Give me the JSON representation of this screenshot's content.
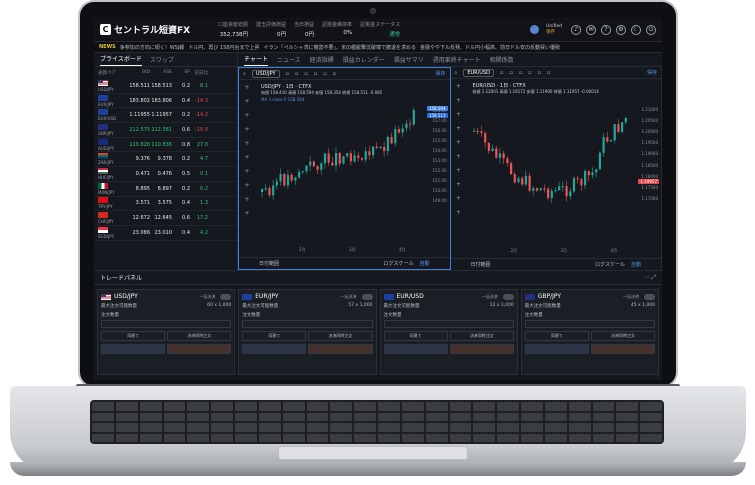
{
  "brand": {
    "name": "セントラル短資FX"
  },
  "header": {
    "stats": [
      {
        "label": "口座資産総額",
        "value": "352,738円",
        "green": false
      },
      {
        "label": "建玉評価損益",
        "value": "0円",
        "green": false
      },
      {
        "label": "当日損益",
        "value": "0円",
        "green": false
      },
      {
        "label": "証拠金維持率",
        "value": "0%",
        "green": false
      },
      {
        "label": "証拠金ステータス",
        "value": "通常",
        "green": true
      }
    ],
    "user": {
      "name": "Unified",
      "status": "保存"
    }
  },
  "news": {
    "tag": "NEWS",
    "items": [
      "争参加の方向に傾く！WSJ報",
      "ドル円、再び 158円台まで上昇",
      "イラン「ペルシャ湾に機雷不要」、米の艦艇撃沈破壊で撤退を求める",
      "金融やや下ル反発、ドル円小幅高、前日ドル安の反動買い優勢"
    ]
  },
  "rates": {
    "tabs": [
      "プライスボード",
      "スワップ"
    ],
    "columns": [
      "通貨ペア",
      "BID",
      "ASK",
      "SP",
      "前日比"
    ],
    "rows": [
      {
        "pair": "USD/JPY",
        "bid": "158.511",
        "ask": "158.513",
        "sp": "0.2",
        "chg": "8.1",
        "up": false,
        "chgPos": true,
        "flag": "us"
      },
      {
        "pair": "EUR/JPY",
        "bid": "183.802",
        "ask": "183.806",
        "sp": "0.4",
        "chg": "-14.3",
        "up": false,
        "chgPos": false,
        "flag": "eu"
      },
      {
        "pair": "EUR/USD",
        "bid": "1.11955",
        "ask": "1.11957",
        "sp": "0.2",
        "chg": "-14.2",
        "up": false,
        "chgPos": false,
        "flag": "eu"
      },
      {
        "pair": "GBP/JPY",
        "bid": "212.575",
        "ask": "212.581",
        "sp": "0.6",
        "chg": "-15.0",
        "up": true,
        "chgPos": false,
        "flag": "gb"
      },
      {
        "pair": "AUD/JPY",
        "bid": "110.828",
        "ask": "110.836",
        "sp": "0.8",
        "chg": "27.0",
        "up": true,
        "chgPos": true,
        "flag": "au"
      },
      {
        "pair": "ZAR/JPY",
        "bid": "9.376",
        "ask": "9.378",
        "sp": "0.2",
        "chg": "4.7",
        "up": false,
        "chgPos": true,
        "flag": "za"
      },
      {
        "pair": "HUF/JPY",
        "bid": "0.471",
        "ask": "0.476",
        "sp": "0.5",
        "chg": "0.1",
        "up": false,
        "chgPos": true,
        "flag": "hu"
      },
      {
        "pair": "MXN/JPY",
        "bid": "8.895",
        "ask": "8.897",
        "sp": "0.2",
        "chg": "0.2",
        "up": false,
        "chgPos": true,
        "flag": "mx"
      },
      {
        "pair": "TRY/JPY",
        "bid": "3.571",
        "ask": "3.575",
        "sp": "0.4",
        "chg": "1.3",
        "up": false,
        "chgPos": true,
        "flag": "tr"
      },
      {
        "pair": "CHF/JPY",
        "bid": "12.672",
        "ask": "12.645",
        "sp": "0.6",
        "chg": "17.2",
        "up": false,
        "chgPos": true,
        "flag": "ch"
      },
      {
        "pair": "SGD/JPY",
        "bid": "23.086",
        "ask": "23.010",
        "sp": "0.4",
        "chg": "4.2",
        "up": false,
        "chgPos": true,
        "flag": "sg"
      }
    ]
  },
  "chart_tabs": [
    "チャート",
    "ニュース",
    "経済指標",
    "損益カレンダー",
    "損益サマリ",
    "週用果終チャート",
    "相関係数"
  ],
  "charts": [
    {
      "symbol": "USD/JPY",
      "title": "USD/JPY · 1日 · CTFX",
      "order": "保存",
      "vals": "始値 158.410 高値 158.594 安値 158.354 終値 158.511 -0.085",
      "ma": "MA 3 close 0 158.594",
      "prices": [
        "158.00",
        "157.00",
        "156.00",
        "155.00",
        "154.00",
        "153.00",
        "152.00",
        "151.00",
        "150.00",
        "149.00"
      ],
      "tag1": "158.594",
      "tag2": "158.513",
      "months": [
        "2月",
        "3月",
        "4月"
      ],
      "range": "日付範囲",
      "scale": "ログスケール",
      "auto": "自動"
    },
    {
      "symbol": "EUR/USD",
      "title": "EUR/USD · 1日 · CTFX",
      "order": "保存",
      "vals": "始値 1.12001 高値 1.16172 安値 1.11900 終値 1.11957 -0.00014",
      "ma": "",
      "prices": [
        "1.21000",
        "1.20500",
        "1.20000",
        "1.19500",
        "1.19000",
        "1.18500",
        "1.18000",
        "1.17500",
        "1.17000"
      ],
      "tag1": "1.19957",
      "tag2": "",
      "months": [
        "2月",
        "3月",
        "4月"
      ],
      "range": "日付範囲",
      "scale": "ログスケール",
      "auto": "自動"
    }
  ],
  "trade": {
    "title": "トレードパネル",
    "cards": [
      {
        "pair": "USD/JPY",
        "flag": "us",
        "oc": "一括決済",
        "max": "最大注文可能数量",
        "maxv": "60 x 1,000",
        "qty": "注文数量",
        "btn1": "両建て",
        "btn2": "決済同時注文"
      },
      {
        "pair": "EUR/JPY",
        "flag": "eu",
        "oc": "一括決済",
        "max": "最大注文可能数量",
        "maxv": "57 x 1,000",
        "qty": "注文数量",
        "btn1": "両建て",
        "btn2": "決済同時注文"
      },
      {
        "pair": "EUR/USD",
        "flag": "eu",
        "oc": "一括決済",
        "max": "最大注文可能数量",
        "maxv": "12 x 1,000",
        "qty": "注文数量",
        "btn1": "両建て",
        "btn2": "決済同時注文"
      },
      {
        "pair": "GBP/JPY",
        "flag": "gb",
        "oc": "一括決済",
        "max": "最大注文可能数量",
        "maxv": "45 x 1,000",
        "qty": "注文数量",
        "btn1": "両建て",
        "btn2": "決済同時注文"
      }
    ]
  }
}
